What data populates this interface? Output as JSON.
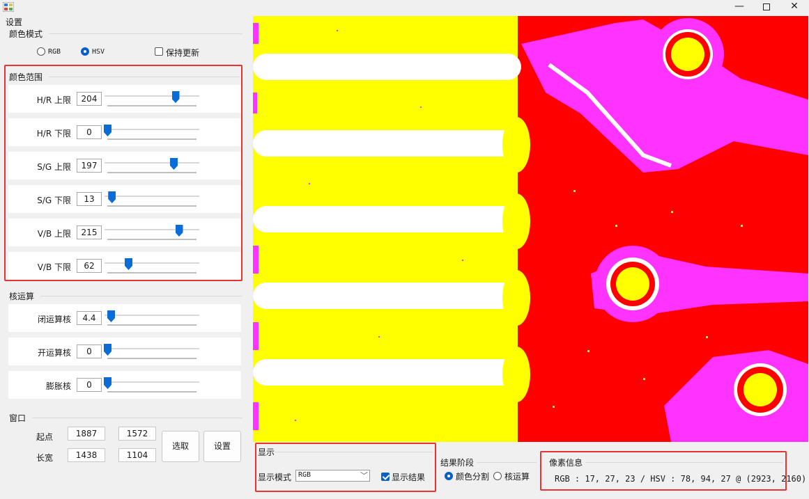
{
  "window": {
    "minimize": "—",
    "close": "✕"
  },
  "settings": {
    "title": "设置",
    "color_mode": {
      "title": "颜色模式",
      "rgb_label": "RGB",
      "hsv_label": "HSV",
      "selected": "HSV",
      "keep_update_label": "保持更新",
      "keep_update_checked": false
    },
    "color_range": {
      "title": "颜色范围",
      "sliders": [
        {
          "label": "H/R 上限",
          "value": "204",
          "position": 0.78
        },
        {
          "label": "H/R 下限",
          "value": "0",
          "position": 0.0
        },
        {
          "label": "S/G 上限",
          "value": "197",
          "position": 0.76
        },
        {
          "label": "S/G 下限",
          "value": "13",
          "position": 0.05
        },
        {
          "label": "V/B 上限",
          "value": "215",
          "position": 0.82
        },
        {
          "label": "V/B 下限",
          "value": "62",
          "position": 0.24
        }
      ]
    },
    "kernel": {
      "title": "核运算",
      "sliders": [
        {
          "label": "闭运算核",
          "value": "4.4",
          "position": 0.04
        },
        {
          "label": "开运算核",
          "value": "0",
          "position": 0.0
        },
        {
          "label": "膨胀核",
          "value": "0",
          "position": 0.0
        }
      ]
    },
    "window_group": {
      "title": "窗口",
      "start_label": "起点",
      "size_label": "长宽",
      "start_x": "1887",
      "start_y": "1572",
      "width": "1438",
      "height": "1104",
      "select_button": "选取",
      "set_button": "设置"
    }
  },
  "display": {
    "title": "显示",
    "mode_label": "显示模式",
    "mode_value": "RGB",
    "show_result_label": "显示结果",
    "show_result_checked": true
  },
  "result_stage": {
    "title": "结果阶段",
    "color_split_label": "颜色分割",
    "kernel_op_label": "核运算",
    "selected": "颜色分割"
  },
  "pixel_info": {
    "title": "像素信息",
    "text": "RGB : 17, 27, 23 / HSV : 78, 94, 27 @ (2923, 2160)"
  },
  "colors": {
    "accent": "#0a6cd6",
    "highlight_box": "#e83333",
    "seg_yellow": "#ffff00",
    "seg_red": "#ff0000",
    "seg_magenta": "#ff33ff",
    "seg_white": "#ffffff"
  }
}
